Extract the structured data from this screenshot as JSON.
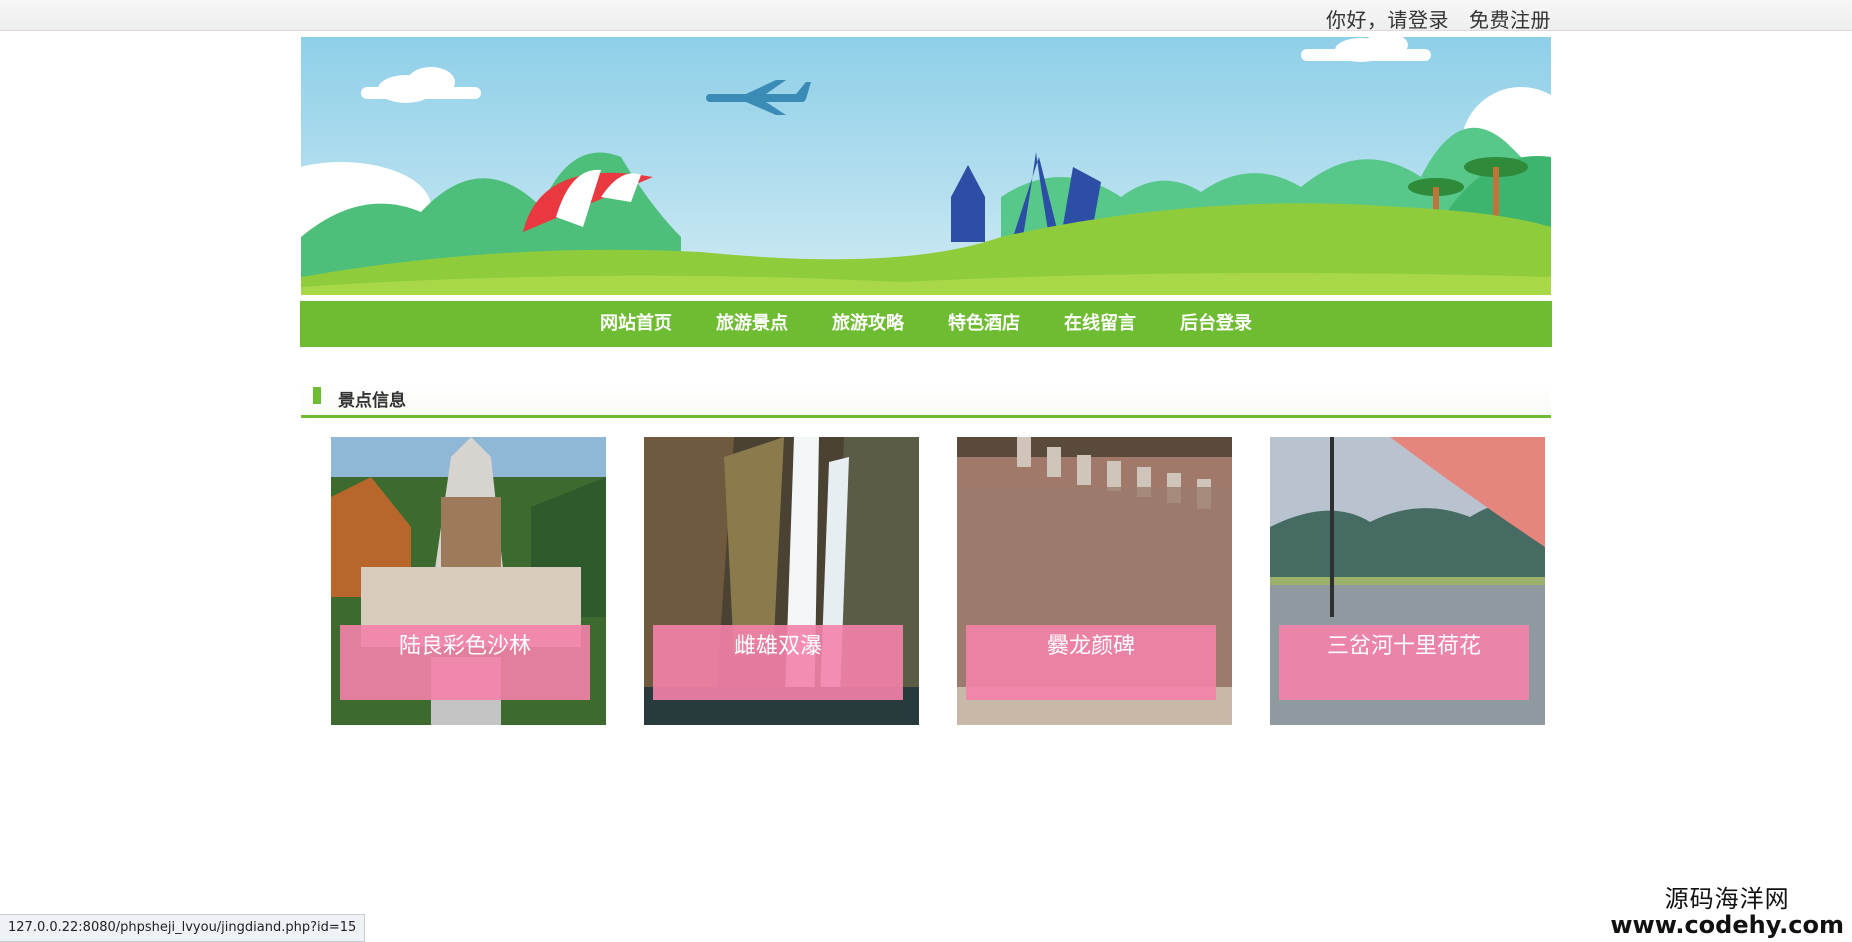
{
  "topbar": {
    "greeting": "你好，",
    "login": "请登录",
    "register": "免费注册"
  },
  "nav": {
    "items": [
      {
        "label": "网站首页"
      },
      {
        "label": "旅游景点"
      },
      {
        "label": "旅游攻略"
      },
      {
        "label": "特色酒店"
      },
      {
        "label": "在线留言"
      },
      {
        "label": "后台登录"
      }
    ]
  },
  "section": {
    "title": "景点信息"
  },
  "spots": [
    {
      "name": "陆良彩色沙林"
    },
    {
      "name": "雌雄双瀑"
    },
    {
      "name": "爨龙颜碑"
    },
    {
      "name": "三岔河十里荷花"
    }
  ],
  "status_url": "127.0.0.22:8080/phpsheji_lvyou/jingdiand.php?id=15",
  "watermark": {
    "cn": "源码海洋网",
    "url": "www.codehy.com"
  },
  "colors": {
    "nav_green": "#6ebc31",
    "caption_pink": "#f482aa",
    "sky": "#97d2e9"
  }
}
